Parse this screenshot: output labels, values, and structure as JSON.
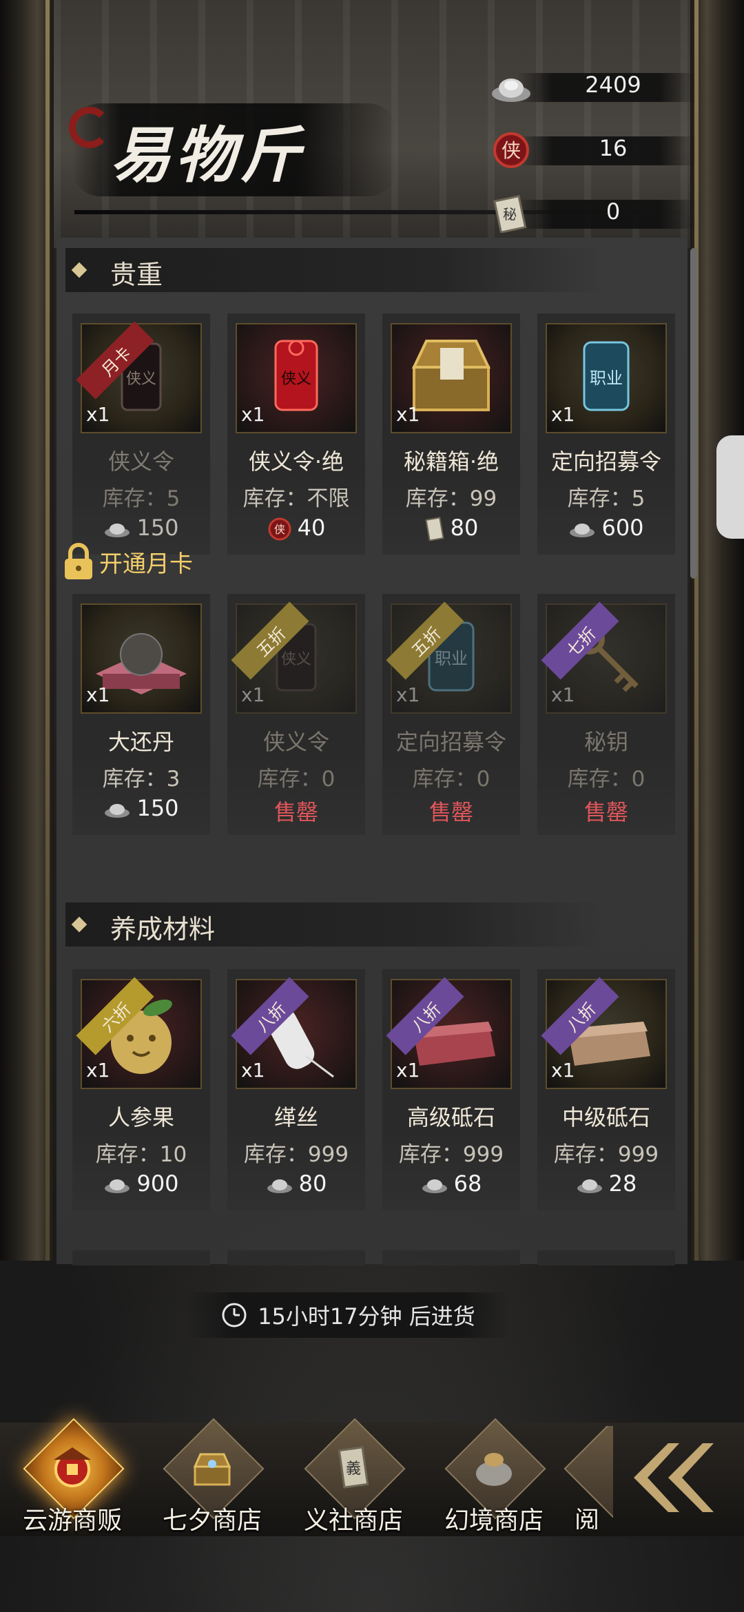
{
  "header": {
    "title": "易物斤",
    "currencies": [
      {
        "icon": "silver-ingot-icon",
        "value": "2409"
      },
      {
        "icon": "xia-token-icon",
        "value": "16"
      },
      {
        "icon": "secret-book-icon",
        "value": "0"
      }
    ]
  },
  "sections": [
    {
      "title": "贵重",
      "items": [
        {
          "badge": "月卡",
          "qty": "x1",
          "name": "侠义令",
          "stock": "库存：5",
          "price": "150",
          "price_icon": "silver-ingot-icon",
          "state": "locked"
        },
        {
          "badge": "",
          "qty": "x1",
          "name": "侠义令·绝",
          "stock": "库存：不限",
          "price": "40",
          "price_icon": "xia-token-icon",
          "state": "available"
        },
        {
          "badge": "",
          "qty": "x1",
          "name": "秘籍箱·绝",
          "stock": "库存：99",
          "price": "80",
          "price_icon": "secret-book-icon",
          "state": "available"
        },
        {
          "badge": "",
          "qty": "x1",
          "name": "定向招募令",
          "stock": "库存：5",
          "price": "600",
          "price_icon": "silver-ingot-icon",
          "state": "available"
        },
        {
          "badge": "",
          "qty": "x1",
          "name": "大还丹",
          "stock": "库存：3",
          "price": "150",
          "price_icon": "silver-ingot-icon",
          "state": "available"
        },
        {
          "badge": "五折",
          "qty": "x1",
          "name": "侠义令",
          "stock": "库存：0",
          "price": "售罄",
          "state": "soldout"
        },
        {
          "badge": "五折",
          "qty": "x1",
          "name": "定向招募令",
          "stock": "库存：0",
          "price": "售罄",
          "state": "soldout"
        },
        {
          "badge": "七折",
          "qty": "x1",
          "name": "秘钥",
          "stock": "库存：0",
          "price": "售罄",
          "state": "soldout"
        }
      ],
      "unlock_label": "开通月卡"
    },
    {
      "title": "养成材料",
      "items": [
        {
          "badge": "六折",
          "qty": "x1",
          "name": "人参果",
          "stock": "库存：10",
          "price": "900",
          "price_icon": "silver-ingot-icon",
          "state": "available"
        },
        {
          "badge": "八折",
          "qty": "x1",
          "name": "缂丝",
          "stock": "库存：999",
          "price": "80",
          "price_icon": "silver-ingot-icon",
          "state": "available"
        },
        {
          "badge": "八折",
          "qty": "x1",
          "name": "高级砥石",
          "stock": "库存：999",
          "price": "68",
          "price_icon": "silver-ingot-icon",
          "state": "available"
        },
        {
          "badge": "八折",
          "qty": "x1",
          "name": "中级砥石",
          "stock": "库存：999",
          "price": "28",
          "price_icon": "silver-ingot-icon",
          "state": "available"
        }
      ]
    }
  ],
  "restock": {
    "text": "15小时17分钟 后进货",
    "icon": "clock-icon"
  },
  "bottom_nav": [
    {
      "label": "云游商贩",
      "icon": "merchant-icon",
      "active": true
    },
    {
      "label": "七夕商店",
      "icon": "treasure-chest-icon",
      "active": false
    },
    {
      "label": "义社商店",
      "icon": "scroll-icon",
      "active": false
    },
    {
      "label": "幻境商店",
      "icon": "bag-icon",
      "active": false
    },
    {
      "label": "阅",
      "icon": "book-icon",
      "active": false
    }
  ],
  "colors": {
    "soldout": "#e0565a",
    "unlock": "#f3ce6a",
    "accent_gold": "#d8c697"
  }
}
